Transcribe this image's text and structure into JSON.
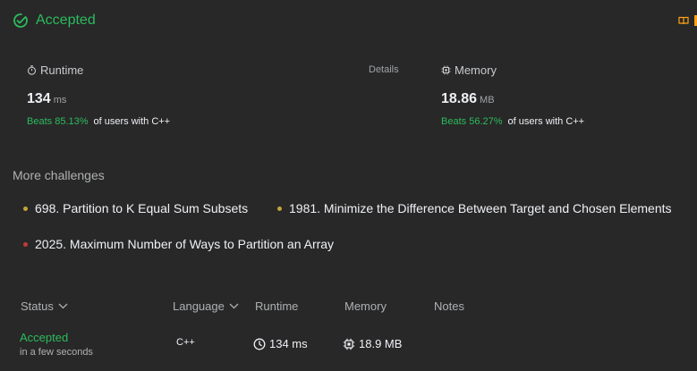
{
  "header": {
    "title": "Accepted"
  },
  "runtime": {
    "label": "Runtime",
    "value": "134",
    "unit": "ms",
    "beats_prefix": "Beats",
    "beats_pct": "85.13%",
    "beats_suffix": "of users with C++"
  },
  "details_label": "Details",
  "memory": {
    "label": "Memory",
    "value": "18.86",
    "unit": "MB",
    "beats_prefix": "Beats",
    "beats_pct": "56.27%",
    "beats_suffix": "of users with C++"
  },
  "more_challenges": {
    "title": "More challenges",
    "items": [
      {
        "label": "698. Partition to K Equal Sum Subsets",
        "color": "#c4a53a"
      },
      {
        "label": "1981. Minimize the Difference Between Target and Chosen Elements",
        "color": "#c4a53a"
      },
      {
        "label": "2025. Maximum Number of Ways to Partition an Array",
        "color": "#c03a3a"
      }
    ]
  },
  "table": {
    "headers": {
      "status": "Status",
      "language": "Language",
      "runtime": "Runtime",
      "memory": "Memory",
      "notes": "Notes"
    },
    "rows": [
      {
        "status": "Accepted",
        "time": "in a few seconds",
        "language": "C++",
        "runtime": "134 ms",
        "memory": "18.9 MB"
      }
    ]
  },
  "colors": {
    "accepted": "#2cbb5d",
    "background": "#282828",
    "accent": "#ffa116"
  }
}
